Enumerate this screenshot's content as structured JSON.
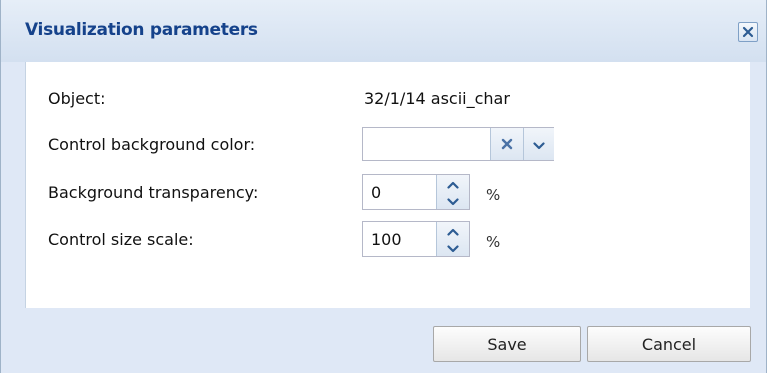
{
  "dialog": {
    "title": "Visualization parameters"
  },
  "form": {
    "object_label": "Object:",
    "object_value": "32/1/14 ascii_char",
    "bg_color_label": "Control background color:",
    "bg_color_value": "",
    "transparency_label": "Background transparency:",
    "transparency_value": "0",
    "transparency_unit": "%",
    "scale_label": "Control size scale:",
    "scale_value": "100",
    "scale_unit": "%"
  },
  "buttons": {
    "save_label": "Save",
    "cancel_label": "Cancel"
  },
  "icons": {
    "close": "close-icon",
    "clear": "clear-x-icon",
    "dropdown": "chevron-down-icon",
    "up": "chevron-up-icon",
    "down": "chevron-down-icon"
  },
  "colors": {
    "title_text": "#15428b",
    "frame_bg": "#dfe8f6",
    "icon_blue": "#4a72a6"
  }
}
